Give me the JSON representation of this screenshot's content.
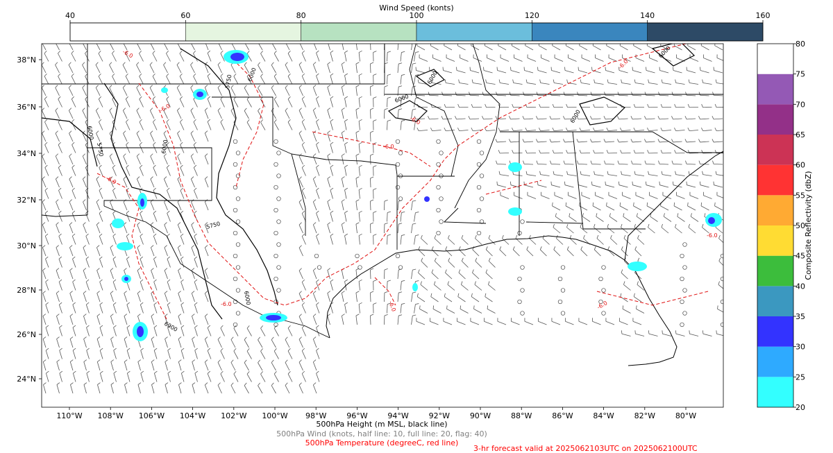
{
  "wind_colorbar": {
    "title": "Wind Speed (konts)",
    "ticks": [
      "40",
      "60",
      "80",
      "100",
      "120",
      "140",
      "160"
    ],
    "colors": [
      "#ffffff",
      "#e5f5e0",
      "#b7e2c1",
      "#6bbedc",
      "#3a86be",
      "#2d4a66"
    ]
  },
  "refl_colorbar": {
    "title": "Composite Reflectivity (dbZ)",
    "ticks": [
      "20",
      "25",
      "30",
      "35",
      "40",
      "45",
      "50",
      "55",
      "60",
      "65",
      "70",
      "75",
      "80"
    ],
    "colors": [
      "#33ffff",
      "#2eaaff",
      "#3333ff",
      "#3b98c0",
      "#3cbd3c",
      "#ffdc33",
      "#ffaa33",
      "#ff3333",
      "#cc3355",
      "#933088",
      "#9459b5",
      "#ffffff"
    ]
  },
  "map": {
    "lon_ticks": [
      "110°W",
      "108°W",
      "106°W",
      "104°W",
      "102°W",
      "100°W",
      "98°W",
      "96°W",
      "94°W",
      "92°W",
      "90°W",
      "88°W",
      "86°W",
      "84°W",
      "82°W",
      "80°W"
    ],
    "lat_ticks": [
      "38°N",
      "36°N",
      "34°N",
      "32°N",
      "30°N",
      "28°N",
      "26°N",
      "24°N"
    ],
    "contour_labels": [
      "6000",
      "5750",
      "6000",
      "6000",
      "6000",
      "6000",
      "5750",
      "6000",
      "6000",
      "6000",
      "5750",
      "6000"
    ],
    "temp_labels": [
      "-6.0",
      "-6.0",
      "-6.0",
      "-6.0",
      "-6.0",
      "-6.0",
      "-6.0",
      "-6.0",
      "-6.0",
      "-6.0"
    ]
  },
  "captions": {
    "line1": "500hPa Height (m MSL, black line)",
    "line2": "500hPa Wind (knots, half line: 10, full line: 20, flag: 40)",
    "line3": "500hPa Temperature (degreeC, red line)",
    "forecast": "3-hr forecast valid at 2025062103UTC on 2025062100UTC"
  },
  "styles": {
    "caption2_color": "#808080",
    "caption3_color": "#ff0000",
    "height_color": "#000000",
    "temp_color": "#e01010",
    "barb_color": "#555555"
  }
}
